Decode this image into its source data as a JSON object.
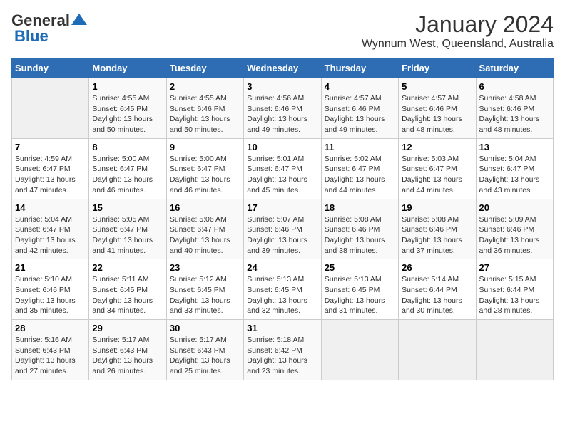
{
  "header": {
    "logo_general": "General",
    "logo_blue": "Blue",
    "month": "January 2024",
    "location": "Wynnum West, Queensland, Australia"
  },
  "days_of_week": [
    "Sunday",
    "Monday",
    "Tuesday",
    "Wednesday",
    "Thursday",
    "Friday",
    "Saturday"
  ],
  "weeks": [
    [
      {
        "day": "",
        "empty": true
      },
      {
        "day": "1",
        "sunrise": "4:55 AM",
        "sunset": "6:45 PM",
        "daylight": "13 hours and 50 minutes."
      },
      {
        "day": "2",
        "sunrise": "4:55 AM",
        "sunset": "6:46 PM",
        "daylight": "13 hours and 50 minutes."
      },
      {
        "day": "3",
        "sunrise": "4:56 AM",
        "sunset": "6:46 PM",
        "daylight": "13 hours and 49 minutes."
      },
      {
        "day": "4",
        "sunrise": "4:57 AM",
        "sunset": "6:46 PM",
        "daylight": "13 hours and 49 minutes."
      },
      {
        "day": "5",
        "sunrise": "4:57 AM",
        "sunset": "6:46 PM",
        "daylight": "13 hours and 48 minutes."
      },
      {
        "day": "6",
        "sunrise": "4:58 AM",
        "sunset": "6:46 PM",
        "daylight": "13 hours and 48 minutes."
      }
    ],
    [
      {
        "day": "7",
        "sunrise": "4:59 AM",
        "sunset": "6:47 PM",
        "daylight": "13 hours and 47 minutes."
      },
      {
        "day": "8",
        "sunrise": "5:00 AM",
        "sunset": "6:47 PM",
        "daylight": "13 hours and 46 minutes."
      },
      {
        "day": "9",
        "sunrise": "5:00 AM",
        "sunset": "6:47 PM",
        "daylight": "13 hours and 46 minutes."
      },
      {
        "day": "10",
        "sunrise": "5:01 AM",
        "sunset": "6:47 PM",
        "daylight": "13 hours and 45 minutes."
      },
      {
        "day": "11",
        "sunrise": "5:02 AM",
        "sunset": "6:47 PM",
        "daylight": "13 hours and 44 minutes."
      },
      {
        "day": "12",
        "sunrise": "5:03 AM",
        "sunset": "6:47 PM",
        "daylight": "13 hours and 44 minutes."
      },
      {
        "day": "13",
        "sunrise": "5:04 AM",
        "sunset": "6:47 PM",
        "daylight": "13 hours and 43 minutes."
      }
    ],
    [
      {
        "day": "14",
        "sunrise": "5:04 AM",
        "sunset": "6:47 PM",
        "daylight": "13 hours and 42 minutes."
      },
      {
        "day": "15",
        "sunrise": "5:05 AM",
        "sunset": "6:47 PM",
        "daylight": "13 hours and 41 minutes."
      },
      {
        "day": "16",
        "sunrise": "5:06 AM",
        "sunset": "6:47 PM",
        "daylight": "13 hours and 40 minutes."
      },
      {
        "day": "17",
        "sunrise": "5:07 AM",
        "sunset": "6:46 PM",
        "daylight": "13 hours and 39 minutes."
      },
      {
        "day": "18",
        "sunrise": "5:08 AM",
        "sunset": "6:46 PM",
        "daylight": "13 hours and 38 minutes."
      },
      {
        "day": "19",
        "sunrise": "5:08 AM",
        "sunset": "6:46 PM",
        "daylight": "13 hours and 37 minutes."
      },
      {
        "day": "20",
        "sunrise": "5:09 AM",
        "sunset": "6:46 PM",
        "daylight": "13 hours and 36 minutes."
      }
    ],
    [
      {
        "day": "21",
        "sunrise": "5:10 AM",
        "sunset": "6:46 PM",
        "daylight": "13 hours and 35 minutes."
      },
      {
        "day": "22",
        "sunrise": "5:11 AM",
        "sunset": "6:45 PM",
        "daylight": "13 hours and 34 minutes."
      },
      {
        "day": "23",
        "sunrise": "5:12 AM",
        "sunset": "6:45 PM",
        "daylight": "13 hours and 33 minutes."
      },
      {
        "day": "24",
        "sunrise": "5:13 AM",
        "sunset": "6:45 PM",
        "daylight": "13 hours and 32 minutes."
      },
      {
        "day": "25",
        "sunrise": "5:13 AM",
        "sunset": "6:45 PM",
        "daylight": "13 hours and 31 minutes."
      },
      {
        "day": "26",
        "sunrise": "5:14 AM",
        "sunset": "6:44 PM",
        "daylight": "13 hours and 30 minutes."
      },
      {
        "day": "27",
        "sunrise": "5:15 AM",
        "sunset": "6:44 PM",
        "daylight": "13 hours and 28 minutes."
      }
    ],
    [
      {
        "day": "28",
        "sunrise": "5:16 AM",
        "sunset": "6:43 PM",
        "daylight": "13 hours and 27 minutes."
      },
      {
        "day": "29",
        "sunrise": "5:17 AM",
        "sunset": "6:43 PM",
        "daylight": "13 hours and 26 minutes."
      },
      {
        "day": "30",
        "sunrise": "5:17 AM",
        "sunset": "6:43 PM",
        "daylight": "13 hours and 25 minutes."
      },
      {
        "day": "31",
        "sunrise": "5:18 AM",
        "sunset": "6:42 PM",
        "daylight": "13 hours and 23 minutes."
      },
      {
        "day": "",
        "empty": true
      },
      {
        "day": "",
        "empty": true
      },
      {
        "day": "",
        "empty": true
      }
    ]
  ]
}
